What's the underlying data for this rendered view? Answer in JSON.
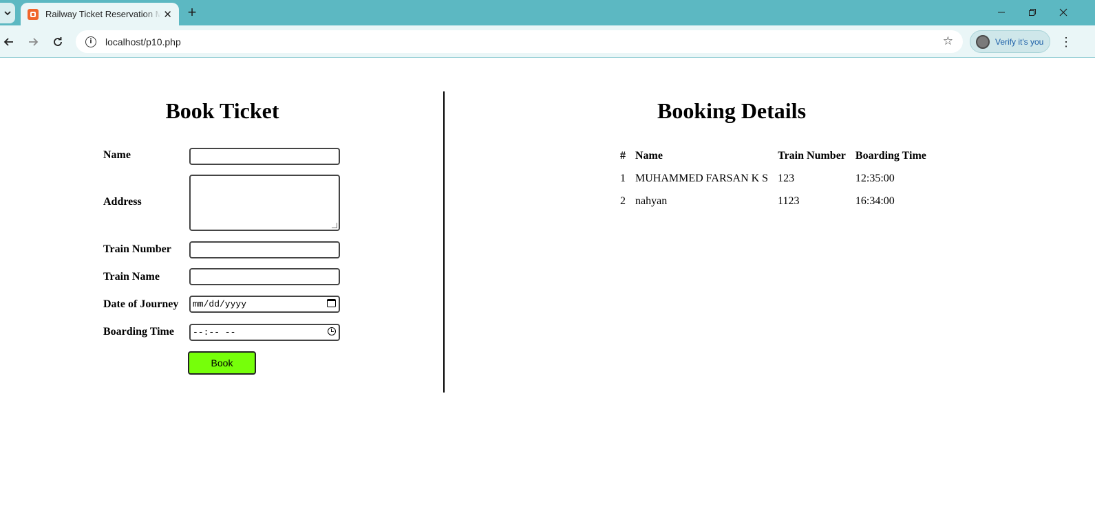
{
  "browser": {
    "tab_title": "Railway Ticket Reservation Management",
    "new_tab_symbol": "+",
    "url": "localhost/p10.php",
    "verify_label": "Verify it's you",
    "icons": [
      "tab-search-icon",
      "favicon-icon",
      "close-icon",
      "plus-icon",
      "minimize-icon",
      "restore-icon",
      "window-close-icon",
      "back-arrow-icon",
      "forward-arrow-icon",
      "reload-icon",
      "site-info-icon",
      "bookmark-star-icon",
      "profile-avatar-icon",
      "more-menu-icon"
    ]
  },
  "form": {
    "heading": "Book Ticket",
    "labels": {
      "name": "Name",
      "address": "Address",
      "train_number": "Train Number",
      "train_name": "Train Name",
      "date": "Date of Journey",
      "time": "Boarding Time"
    },
    "values": {
      "name": "",
      "address": "",
      "train_number": "",
      "train_name": ""
    },
    "date_placeholder": "mm/dd/yyyy",
    "time_placeholder": "--:-- --",
    "submit_label": "Book",
    "submit_color": "#76ff0a"
  },
  "details": {
    "heading": "Booking Details",
    "columns": [
      "#",
      "Name",
      "Train Number",
      "Boarding Time"
    ],
    "rows": [
      [
        "1",
        "MUHAMMED FARSAN K S",
        "123",
        "12:35:00"
      ],
      [
        "2",
        "nahyan",
        "1123",
        "16:34:00"
      ]
    ]
  }
}
